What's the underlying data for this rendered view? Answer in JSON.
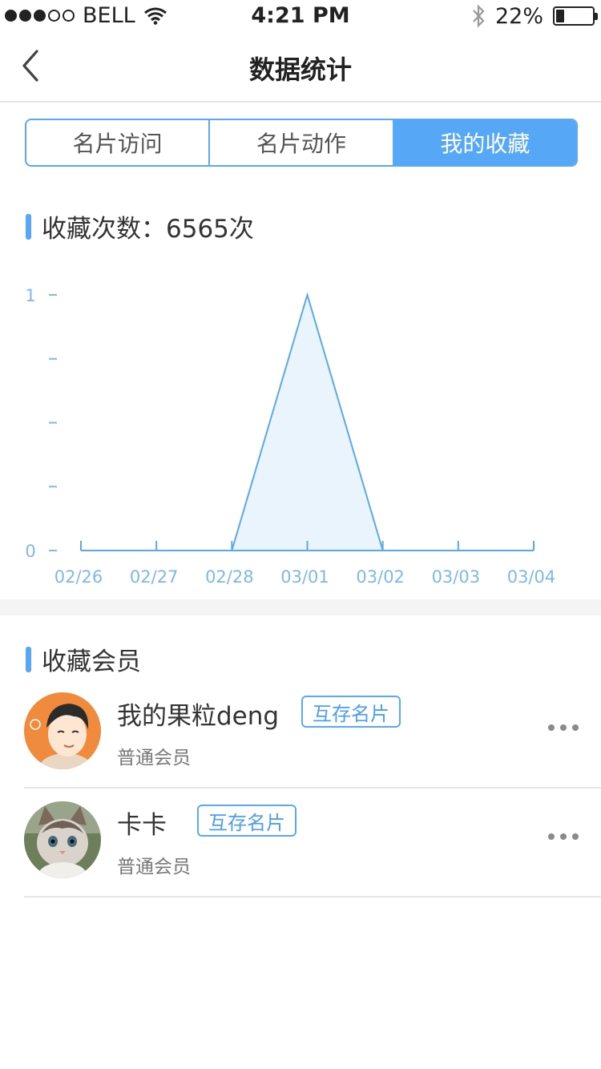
{
  "status_bar": {
    "carrier": "BELL",
    "time": "4:21 PM",
    "battery": "22%",
    "signal_bars_on": 3,
    "signal_bars_total": 5,
    "battery_level": 0.22
  },
  "nav": {
    "title": "数据统计"
  },
  "tabs": [
    {
      "label": "名片访问",
      "active": false
    },
    {
      "label": "名片动作",
      "active": false
    },
    {
      "label": "我的收藏",
      "active": true
    }
  ],
  "stats": {
    "title": "收藏次数：6565次"
  },
  "chart_data": {
    "type": "area",
    "categories": [
      "02/26",
      "02/27",
      "02/28",
      "03/01",
      "03/02",
      "03/03",
      "03/04"
    ],
    "values": [
      0,
      0,
      0,
      1,
      0,
      0,
      0
    ],
    "y_tick_labels": [
      "0",
      "1"
    ],
    "ylim": [
      0,
      1
    ],
    "y_minor_ticks": 4,
    "line_color": "#5aa9e8",
    "fill_color": "#eaf4fc",
    "label_color": "#7fb8ea"
  },
  "members_section": {
    "title": "收藏会员"
  },
  "members": [
    {
      "name": "我的果粒deng",
      "badge": "互存名片",
      "level": "普通会员",
      "avatar": "cartoon-avatar"
    },
    {
      "name": "卡卡",
      "badge": "互存名片",
      "level": "普通会员",
      "avatar": "kitten-avatar"
    }
  ],
  "colors": {
    "accent": "#56a8f6",
    "border": "#5aa9f4"
  }
}
